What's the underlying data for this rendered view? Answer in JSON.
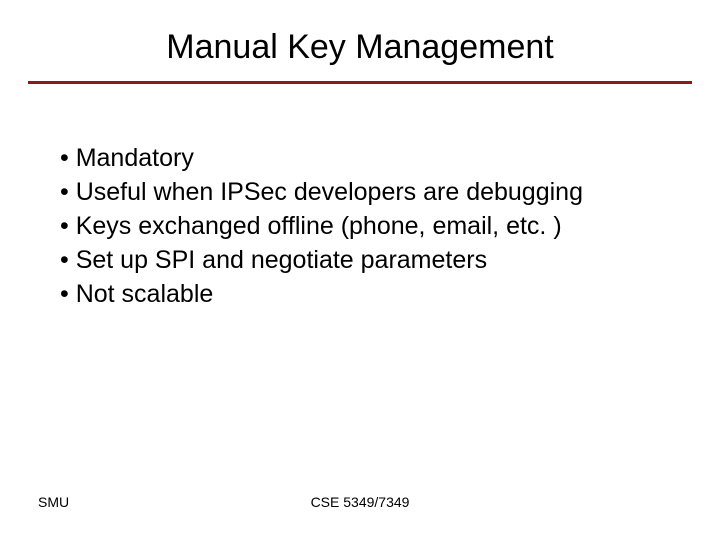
{
  "title": "Manual Key Management",
  "bullets": [
    "Mandatory",
    "Useful when IPSec developers are debugging",
    "Keys exchanged offline (phone, email, etc. )",
    "Set up SPI and negotiate parameters",
    "Not scalable"
  ],
  "footer": {
    "left": "SMU",
    "center": "CSE 5349/7349"
  },
  "colors": {
    "underline": "#8b1a1a"
  }
}
